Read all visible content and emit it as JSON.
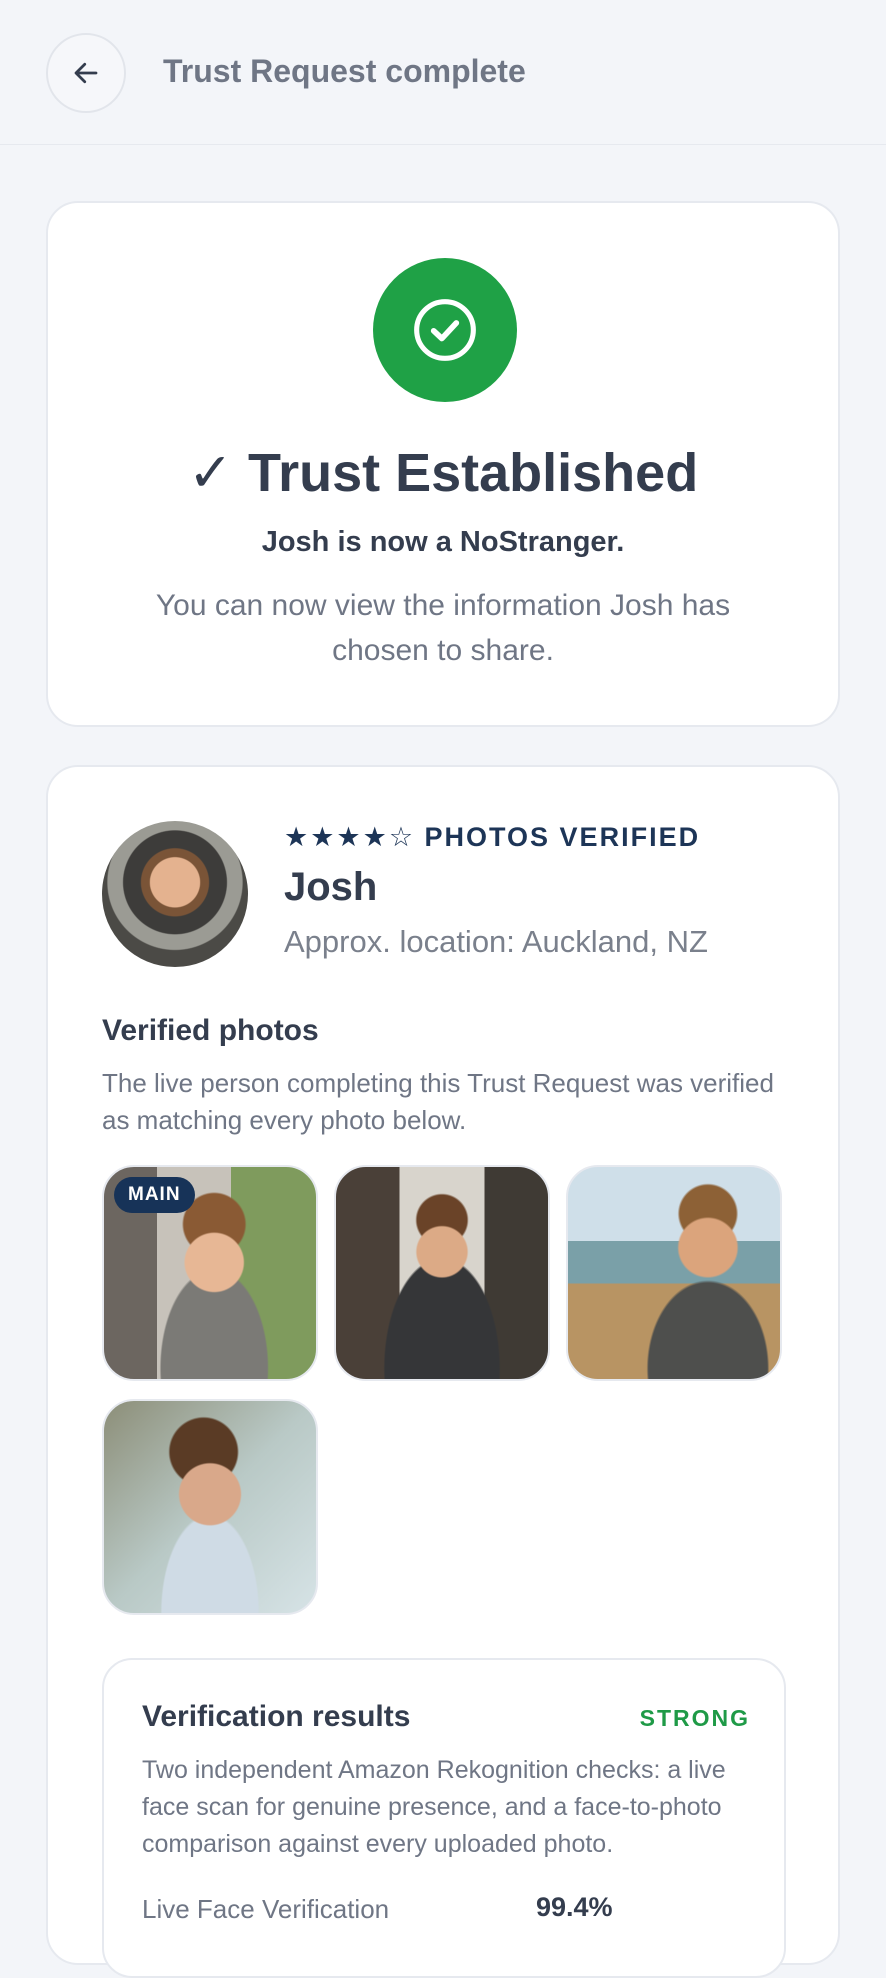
{
  "header": {
    "title": "Trust Request complete",
    "back_icon": "arrow-left-icon"
  },
  "success": {
    "icon": "check-circle-icon",
    "color": "#1fa146",
    "title": "✓ Trust Established",
    "subtitle": "Josh is now a NoStranger.",
    "description": "You can now view the information Josh has chosen to share."
  },
  "profile": {
    "badge": "★★★★☆ PHOTOS VERIFIED",
    "rating": 4,
    "rating_max": 5,
    "name": "Josh",
    "location": "Approx. location: Auckland, NZ"
  },
  "verified_photos": {
    "title": "Verified photos",
    "description": "The live person completing this Trust Request was verified as matching every photo below.",
    "main_label": "MAIN",
    "count": 4
  },
  "results": {
    "title": "Verification results",
    "strength": "STRONG",
    "strength_color": "#1f9a47",
    "description": "Two independent Amazon Rekognition checks: a live face scan for genuine presence, and a face-to-photo comparison against every uploaded photo.",
    "rows": [
      {
        "label": "Live Face Verification",
        "value": "99.4%"
      }
    ]
  }
}
